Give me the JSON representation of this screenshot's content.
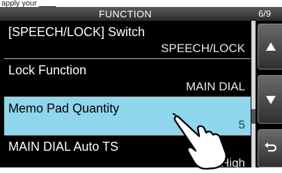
{
  "caption": {
    "prefix": "apply your",
    "underlined": "____"
  },
  "header": {
    "title": "FUNCTION",
    "page": "6/9"
  },
  "items": [
    {
      "label": "[SPEECH/LOCK] Switch",
      "value": "SPEECH/LOCK",
      "selected": false
    },
    {
      "label": "Lock Function",
      "value": "MAIN DIAL",
      "selected": false
    },
    {
      "label": "Memo Pad Quantity",
      "value": "5",
      "selected": true
    },
    {
      "label": "MAIN DIAL Auto TS",
      "value": "High",
      "selected": false
    }
  ],
  "colors": {
    "selected_bg": "#8fd5ec",
    "screen_bg": "#000000"
  },
  "icons": {
    "up": "up-triangle-icon",
    "down": "down-triangle-icon",
    "back": "return-arrow-icon",
    "pointer": "pointing-hand-icon"
  }
}
